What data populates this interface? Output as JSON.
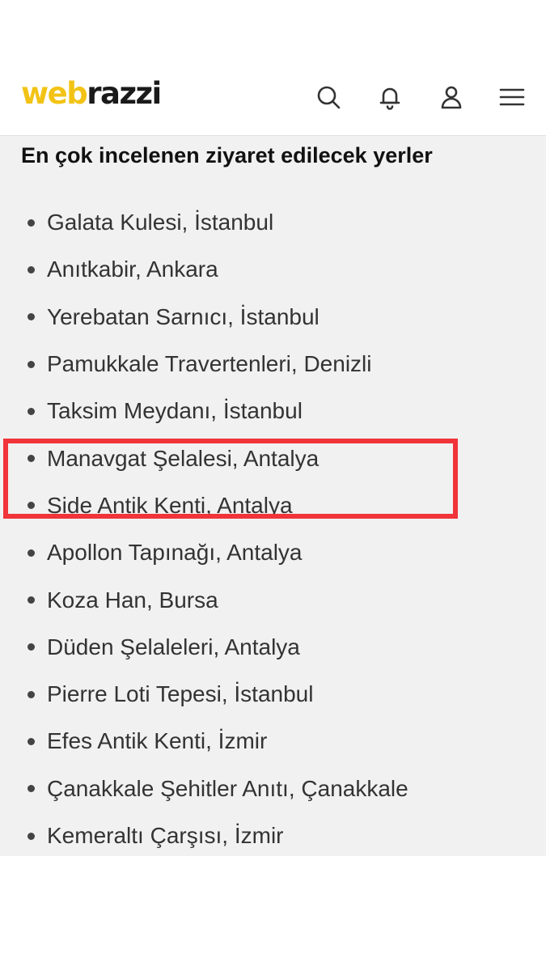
{
  "header": {
    "logo_part1": "web",
    "logo_part2": "razzi",
    "icons": [
      "search-icon",
      "bell-icon",
      "user-icon",
      "menu-icon"
    ],
    "colors": {
      "logo_accent": "#f2c315",
      "highlight": "#f0343a"
    }
  },
  "section": {
    "title": "En çok incelenen ziyaret edilecek yerler"
  },
  "places": [
    "Galata Kulesi, İstanbul",
    "Anıtkabir, Ankara",
    "Yerebatan Sarnıcı, İstanbul",
    "Pamukkale Travertenleri, Denizli",
    "Taksim Meydanı, İstanbul",
    "Manavgat Şelalesi, Antalya",
    "Side Antik Kenti, Antalya",
    "Apollon Tapınağı, Antalya",
    "Koza Han, Bursa",
    "Düden Şelaleleri, Antalya",
    "Pierre Loti Tepesi, İstanbul",
    "Efes Antik Kenti, İzmir",
    "Çanakkale Şehitler Anıtı, Çanakkale",
    "Kemeraltı Çarşısı, İzmir"
  ]
}
